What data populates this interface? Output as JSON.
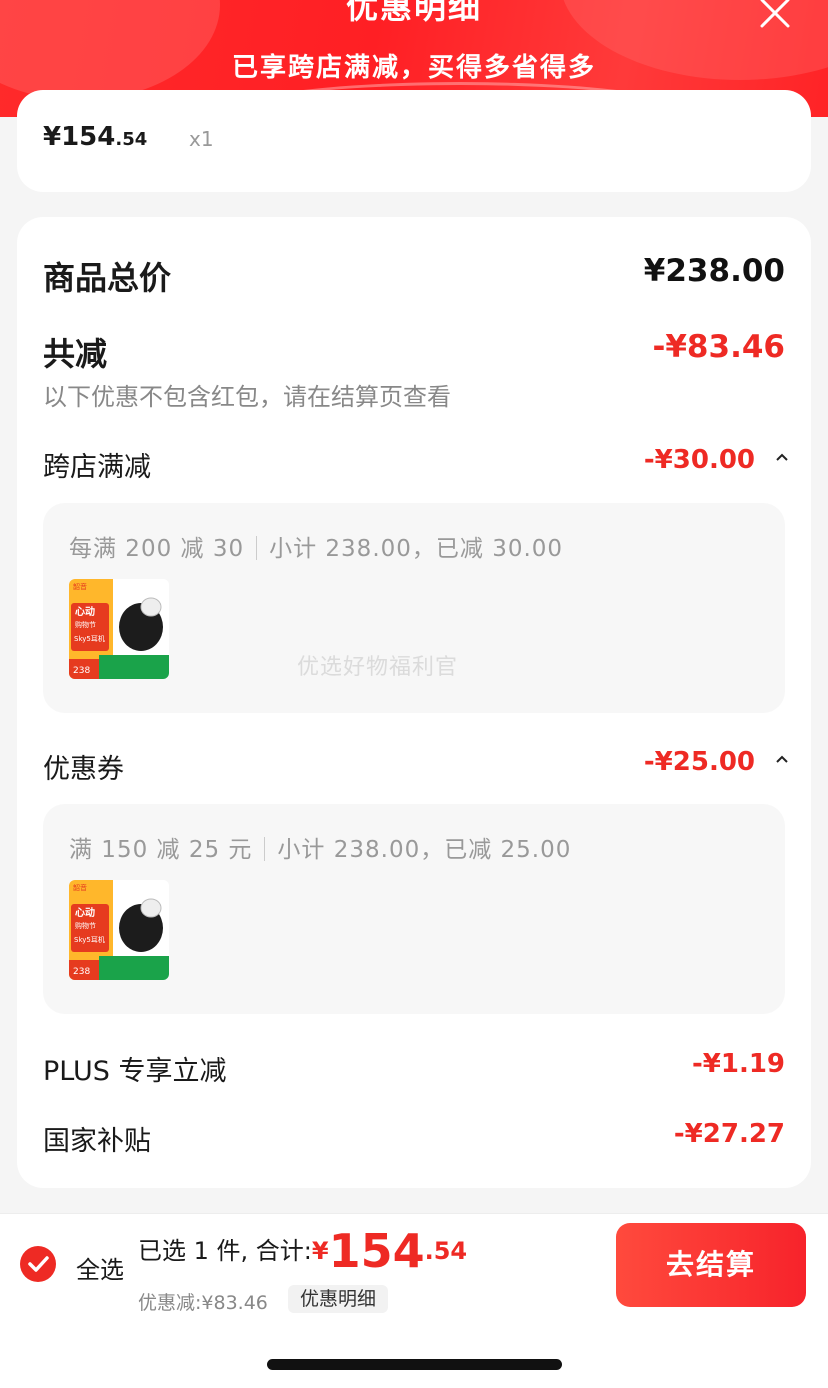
{
  "header": {
    "title": "优惠明细",
    "subtitle": "已享跨店满减，买得多省得多",
    "close_icon": "close-icon"
  },
  "previous_item": {
    "price_main": "¥154",
    "price_cents": ".54",
    "quantity": "x1"
  },
  "summary": {
    "total_label": "商品总价",
    "total_value": "¥238.00",
    "reduce_label": "共减",
    "reduce_value": "-¥83.46",
    "note": "以下优惠不包含红包，请在结算页查看"
  },
  "sections": [
    {
      "label": "跨店满减",
      "value": "-¥30.00",
      "rule_left": "每满 200 减 30",
      "rule_right": "小计 238.00，已减 30.00",
      "watermark": "优选好物福利官",
      "thumb": {
        "brand": "韶音",
        "title": "心动",
        "subtitle": "购物节",
        "product": "Sky5耳机",
        "price": "238"
      }
    },
    {
      "label": "优惠券",
      "value": "-¥25.00",
      "rule_left": "满 150 减 25 元",
      "rule_right": "小计 238.00，已减 25.00",
      "thumb": {
        "brand": "韶音",
        "title": "心动",
        "subtitle": "购物节",
        "product": "Sky5耳机",
        "price": "238"
      }
    }
  ],
  "extras": [
    {
      "label": "PLUS 专享立减",
      "value": "-¥1.19"
    },
    {
      "label": "国家补贴",
      "value": "-¥27.27"
    }
  ],
  "bottom_bar": {
    "select_all": "全选",
    "selected_text": "已选 1 件, 合计:",
    "yen": "¥",
    "total_int": "154",
    "total_dec": ".54",
    "saved_text": "优惠减:¥83.46",
    "detail_chip": "优惠明细",
    "checkout": "去结算"
  },
  "colors": {
    "accent_red": "#ee2a24",
    "header_red": "#ff2a2a",
    "page_bg": "#f5f5f5"
  }
}
